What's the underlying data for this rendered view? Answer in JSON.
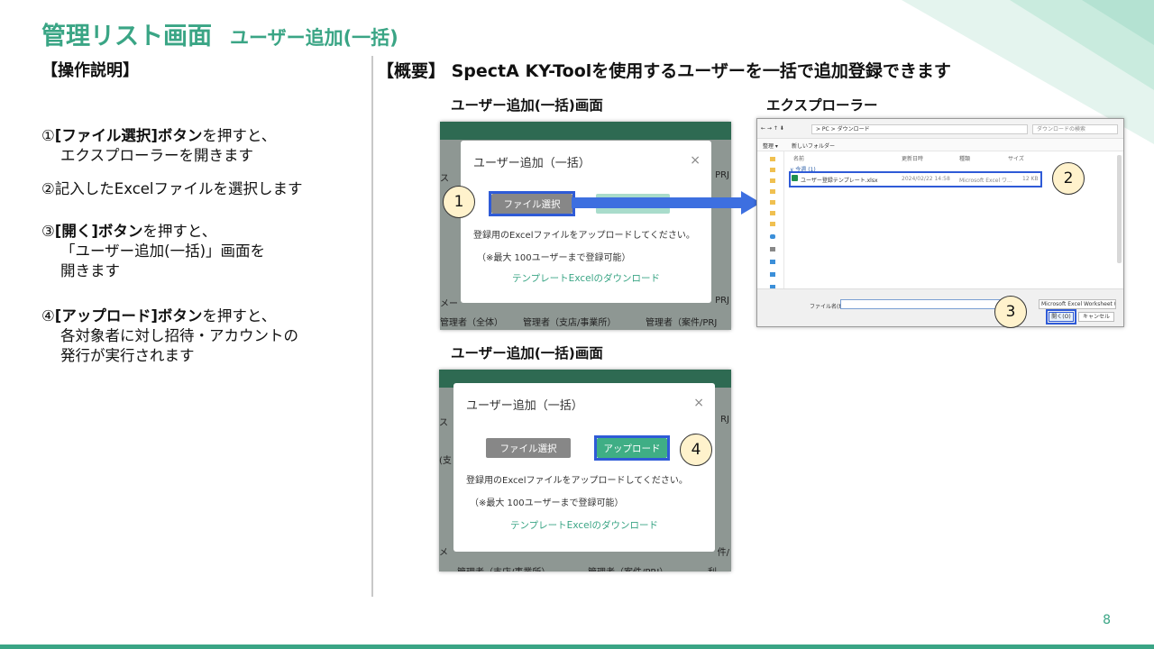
{
  "slide": {
    "title": "管理リスト画面",
    "subtitle": "ユーザー追加(一括)",
    "page_number": "8"
  },
  "left": {
    "header": "【操作説明】",
    "steps": [
      {
        "num": "①",
        "bold": "[ファイル選択]ボタン",
        "rest": "を押すと、",
        "line2": "エクスプローラーを開きます"
      },
      {
        "num": "②",
        "bold": "",
        "rest": "記入したExcelファイルを選択します",
        "line2": ""
      },
      {
        "num": "③",
        "bold": "[開く]ボタン",
        "rest": "を押すと、",
        "line2": "「ユーザー追加(一括)」画面を",
        "line3": "開きます"
      },
      {
        "num": "④",
        "bold": "[アップロード]ボタン",
        "rest": "を押すと、",
        "line2": "各対象者に対し招待・アカウントの",
        "line3": "発行が実行されます"
      }
    ]
  },
  "right": {
    "header": "【概要】 SpectA KY-Toolを使用するユーザーを一括で追加登録できます",
    "caption_top_left": "ユーザー追加(一括)画面",
    "caption_top_right": "エクスプローラー",
    "caption_bottom": "ユーザー追加(一括)画面"
  },
  "dialog": {
    "title": "ユーザー追加（一括）",
    "close": "×",
    "file_button": "ファイル選択",
    "upload_button": "アップロード",
    "instruction": "登録用のExcelファイルをアップロードしてください。",
    "limit_note": "（※最大 100ユーザーまで登録可能）",
    "template_link": "テンプレートExcelのダウンロード"
  },
  "shot1_fragments": {
    "left_edge": "ス",
    "right_edge": "PRJ",
    "mail_left": "メー",
    "mail_right": "PRJ",
    "row1": "管理者（全体）",
    "row2": "管理者（支店/事業所）",
    "row3": "管理者（案件/PRJ"
  },
  "shot2_fragments": {
    "left_edge": "ス",
    "right_edge": "RJ",
    "left_mid": "(支",
    "mail_left": "メ",
    "mail_right": "件/",
    "row1": "管理者（支店/事業所）",
    "row2": "管理者（案件/PRJ）",
    "row3": "利"
  },
  "explorer": {
    "nav": "←  →  ↑  ⬇",
    "path": "> PC > ダウンロード",
    "search_placeholder": "ダウンロードの検索",
    "organize": "整理 ▾",
    "new_folder": "新しいフォルダー",
    "columns": [
      "名前",
      "更新日時",
      "種類",
      "サイズ"
    ],
    "group": "∨ 今週 (1)",
    "file_name": "ユーザー登録テンプレート.xlsx",
    "file_date": "2024/02/22 14:58",
    "file_type": "Microsoft Excel ワ...",
    "file_size": "12 KB",
    "filename_label": "ファイル名(N):",
    "file_type_filter": "Microsoft Excel Worksheet (*.xl",
    "open_button": "開く(O)",
    "cancel_button": "キャンセル"
  },
  "callouts": {
    "c1": "1",
    "c2": "2",
    "c3": "3",
    "c4": "4"
  },
  "colors": {
    "accent": "#3aa585",
    "highlight": "#2f5bd7",
    "callout_fill": "#fff2cc"
  }
}
